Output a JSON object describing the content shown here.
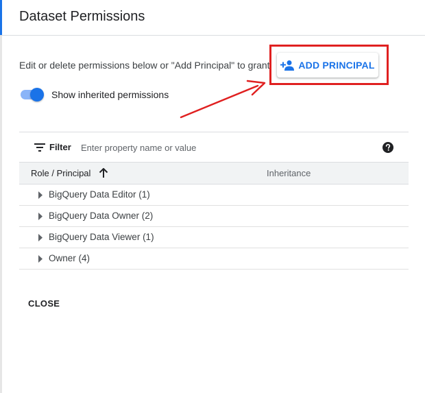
{
  "dialog": {
    "title": "Dataset Permissions",
    "description": "Edit or delete permissions below or \"Add Principal\" to grant new"
  },
  "add_principal": {
    "label": "ADD PRINCIPAL",
    "icon": "person-add-icon"
  },
  "inherited_toggle": {
    "label": "Show inherited permissions",
    "enabled": true
  },
  "filter": {
    "label": "Filter",
    "placeholder": "Enter property name or value",
    "value": ""
  },
  "table": {
    "columns": {
      "role": "Role / Principal",
      "inheritance": "Inheritance"
    },
    "sort": "ascending",
    "rows": [
      {
        "label": "BigQuery Data Editor (1)"
      },
      {
        "label": "BigQuery Data Owner (2)"
      },
      {
        "label": "BigQuery Data Viewer (1)"
      },
      {
        "label": "Owner (4)"
      }
    ]
  },
  "actions": {
    "close_label": "CLOSE"
  },
  "colors": {
    "accent": "#1a73e8",
    "annotation": "#e02020"
  }
}
